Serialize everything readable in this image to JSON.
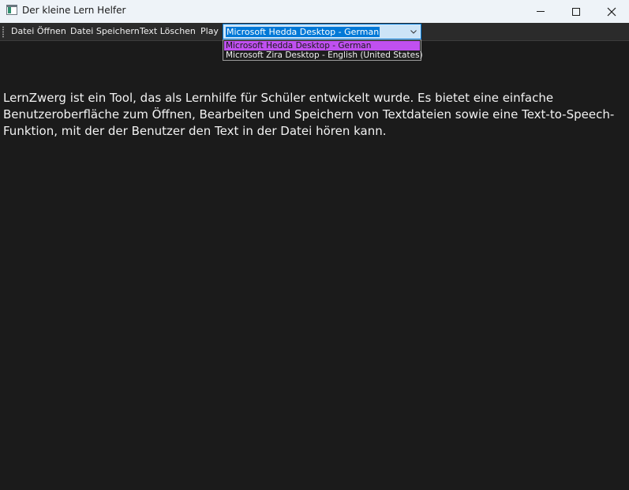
{
  "window": {
    "title": "Der kleine Lern Helfer",
    "icons": {
      "app": "app-window-icon",
      "minimize": "minimize-icon",
      "maximize": "maximize-icon",
      "close": "close-icon"
    }
  },
  "toolbar": {
    "open_label": "Datei Öffnen",
    "save_label": "Datei Speichern",
    "clear_label": "Text Löschen",
    "play_label": "Play"
  },
  "voice_select": {
    "selected": "Microsoft Hedda Desktop - German",
    "options": [
      "Microsoft Hedda Desktop - German",
      "Microsoft Zira Desktop - English (United States)"
    ],
    "highlighted_index": 0
  },
  "content": {
    "text": "LernZwerg ist ein Tool, das als Lernhilfe für Schüler entwickelt wurde. Es bietet eine einfache Benutzeroberfläche zum Öffnen, Bearbeiten und Speichern von Textdateien sowie eine Text-to-Speech-Funktion, mit der der Benutzer den Text in der Datei hören kann."
  },
  "colors": {
    "background": "#1b1b1b",
    "titlebar": "#eef3f8",
    "toolbar": "#2b2b2b",
    "accent": "#0078d7",
    "highlight": "#c050f0"
  }
}
